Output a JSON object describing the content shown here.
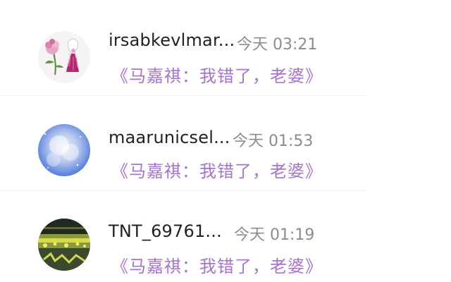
{
  "messages": [
    {
      "username": "irsabkevlmar...",
      "time": "今天 03:21",
      "text": "《马嘉祺：我错了，老婆》",
      "avatar": "flower-drawing-avatar"
    },
    {
      "username": "maarunicsel...",
      "time": "今天 01:53",
      "text": "《马嘉祺：我错了，老婆》",
      "avatar": "blue-sky-avatar"
    },
    {
      "username": "TNT_69761...",
      "time": "今天 01:19",
      "text": "《马嘉祺：我错了，老婆》",
      "avatar": "concert-crowd-avatar"
    }
  ],
  "colors": {
    "message_text": "#a673d0",
    "time_text": "#8c8c8c",
    "username_text": "#222222"
  }
}
